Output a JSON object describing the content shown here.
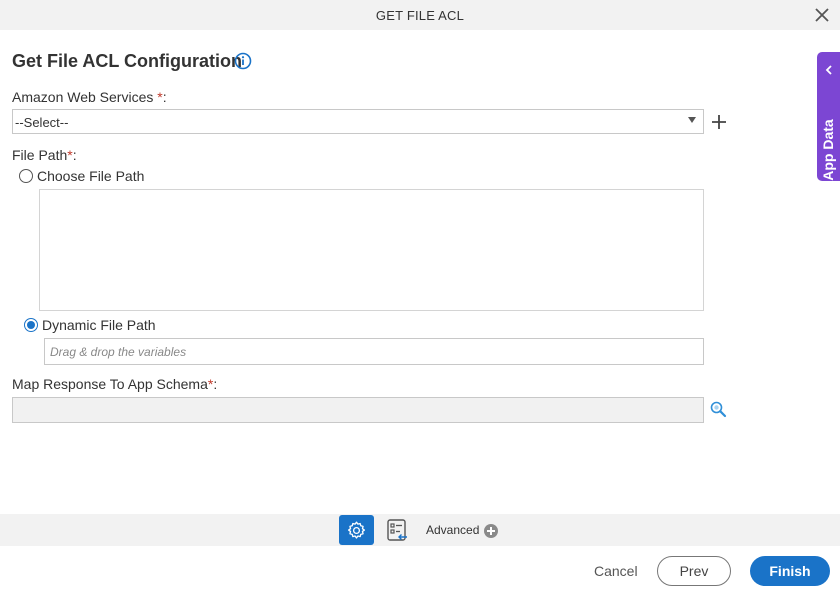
{
  "window": {
    "title": "GET FILE ACL"
  },
  "page": {
    "heading": "Get File ACL Configuration"
  },
  "form": {
    "aws": {
      "label": "Amazon Web Services",
      "required_mark": "*",
      "suffix": ":",
      "selected": "--Select--"
    },
    "file_path": {
      "label": "File Path",
      "required_mark": "*",
      "suffix": ":",
      "options": [
        {
          "label": "Choose File Path",
          "checked": false
        },
        {
          "label": "Dynamic File Path",
          "checked": true
        }
      ],
      "dynamic_placeholder": "Drag & drop the variables"
    },
    "schema": {
      "label": "Map Response To App Schema",
      "required_mark": "*",
      "suffix": ":",
      "value": ""
    }
  },
  "side_panel": {
    "label": "App Data"
  },
  "toolbar": {
    "advanced_label": "Advanced"
  },
  "footer": {
    "cancel": "Cancel",
    "prev": "Prev",
    "finish": "Finish"
  },
  "colors": {
    "primary": "#1a73c8",
    "app_data": "#7c46d3",
    "required": "#c0392b"
  }
}
